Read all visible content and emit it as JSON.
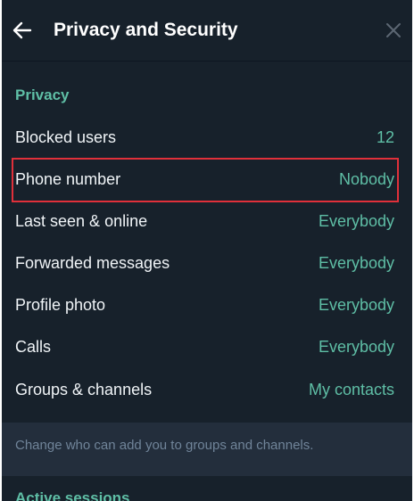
{
  "header": {
    "title": "Privacy and Security",
    "back_icon": "arrow-left-icon",
    "close_icon": "close-icon"
  },
  "privacy": {
    "section_title": "Privacy",
    "items": [
      {
        "label": "Blocked users",
        "value": "12"
      },
      {
        "label": "Phone number",
        "value": "Nobody"
      },
      {
        "label": "Last seen & online",
        "value": "Everybody"
      },
      {
        "label": "Forwarded messages",
        "value": "Everybody"
      },
      {
        "label": "Profile photo",
        "value": "Everybody"
      },
      {
        "label": "Calls",
        "value": "Everybody"
      },
      {
        "label": "Groups & channels",
        "value": "My contacts"
      }
    ],
    "note": "Change who can add you to groups and channels."
  },
  "next_section": {
    "title": "Active sessions"
  },
  "colors": {
    "background": "#17212b",
    "accent": "#5fbfa6",
    "highlight_border": "#e0303a",
    "note_background": "#232e3c"
  }
}
